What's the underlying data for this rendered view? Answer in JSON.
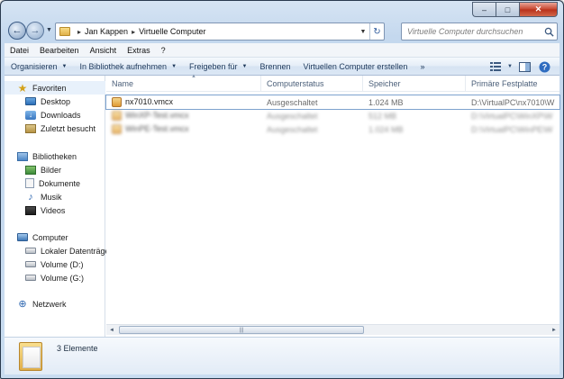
{
  "window": {
    "caption_buttons": {
      "minimize": "–",
      "maximize": "□",
      "close": "✕"
    }
  },
  "address": {
    "crumbs": [
      "Jan Kappen",
      "Virtuelle Computer"
    ],
    "separator": "▸"
  },
  "search": {
    "placeholder": "Virtuelle Computer durchsuchen"
  },
  "menu": [
    "Datei",
    "Bearbeiten",
    "Ansicht",
    "Extras",
    "?"
  ],
  "toolbar": {
    "items": [
      {
        "label": "Organisieren",
        "has_dropdown": true
      },
      {
        "label": "In Bibliothek aufnehmen",
        "has_dropdown": true
      },
      {
        "label": "Freigeben für",
        "has_dropdown": true
      },
      {
        "label": "Brennen",
        "has_dropdown": false
      },
      {
        "label": "Virtuellen Computer erstellen",
        "has_dropdown": false
      },
      {
        "label": "»",
        "has_dropdown": false
      }
    ]
  },
  "nav": {
    "favorites": {
      "label": "Favoriten",
      "items": [
        "Desktop",
        "Downloads",
        "Zuletzt besucht"
      ]
    },
    "libraries": {
      "label": "Bibliotheken",
      "items": [
        "Bilder",
        "Dokumente",
        "Musik",
        "Videos"
      ]
    },
    "computer": {
      "label": "Computer",
      "items": [
        "Lokaler Datenträger",
        "Volume (D:)",
        "Volume (G:)"
      ]
    },
    "network": {
      "label": "Netzwerk"
    }
  },
  "list": {
    "columns": [
      "Name",
      "Computerstatus",
      "Speicher",
      "Primäre Festplatte"
    ],
    "rows": [
      {
        "name": "nx7010.vmcx",
        "status": "Ausgeschaltet",
        "memory": "1.024 MB",
        "disk": "D:\\VirtualPC\\nx7010\\W",
        "blurred": false
      },
      {
        "name": "WinXP-Test.vmcx",
        "status": "Ausgeschaltet",
        "memory": "512 MB",
        "disk": "D:\\VirtualPC\\WinXP\\W",
        "blurred": true
      },
      {
        "name": "WinPE-Test.vmcx",
        "status": "Ausgeschaltet",
        "memory": "1.024 MB",
        "disk": "D:\\VirtualPC\\WinPE\\W",
        "blurred": true
      }
    ]
  },
  "details": {
    "count_text": "3 Elemente"
  },
  "icons": {
    "back": "back-arrow-icon",
    "forward": "forward-arrow-icon",
    "refresh": "refresh-icon",
    "search": "search-icon",
    "views": "view-options-icon",
    "preview": "preview-pane-icon",
    "help": "help-icon"
  }
}
